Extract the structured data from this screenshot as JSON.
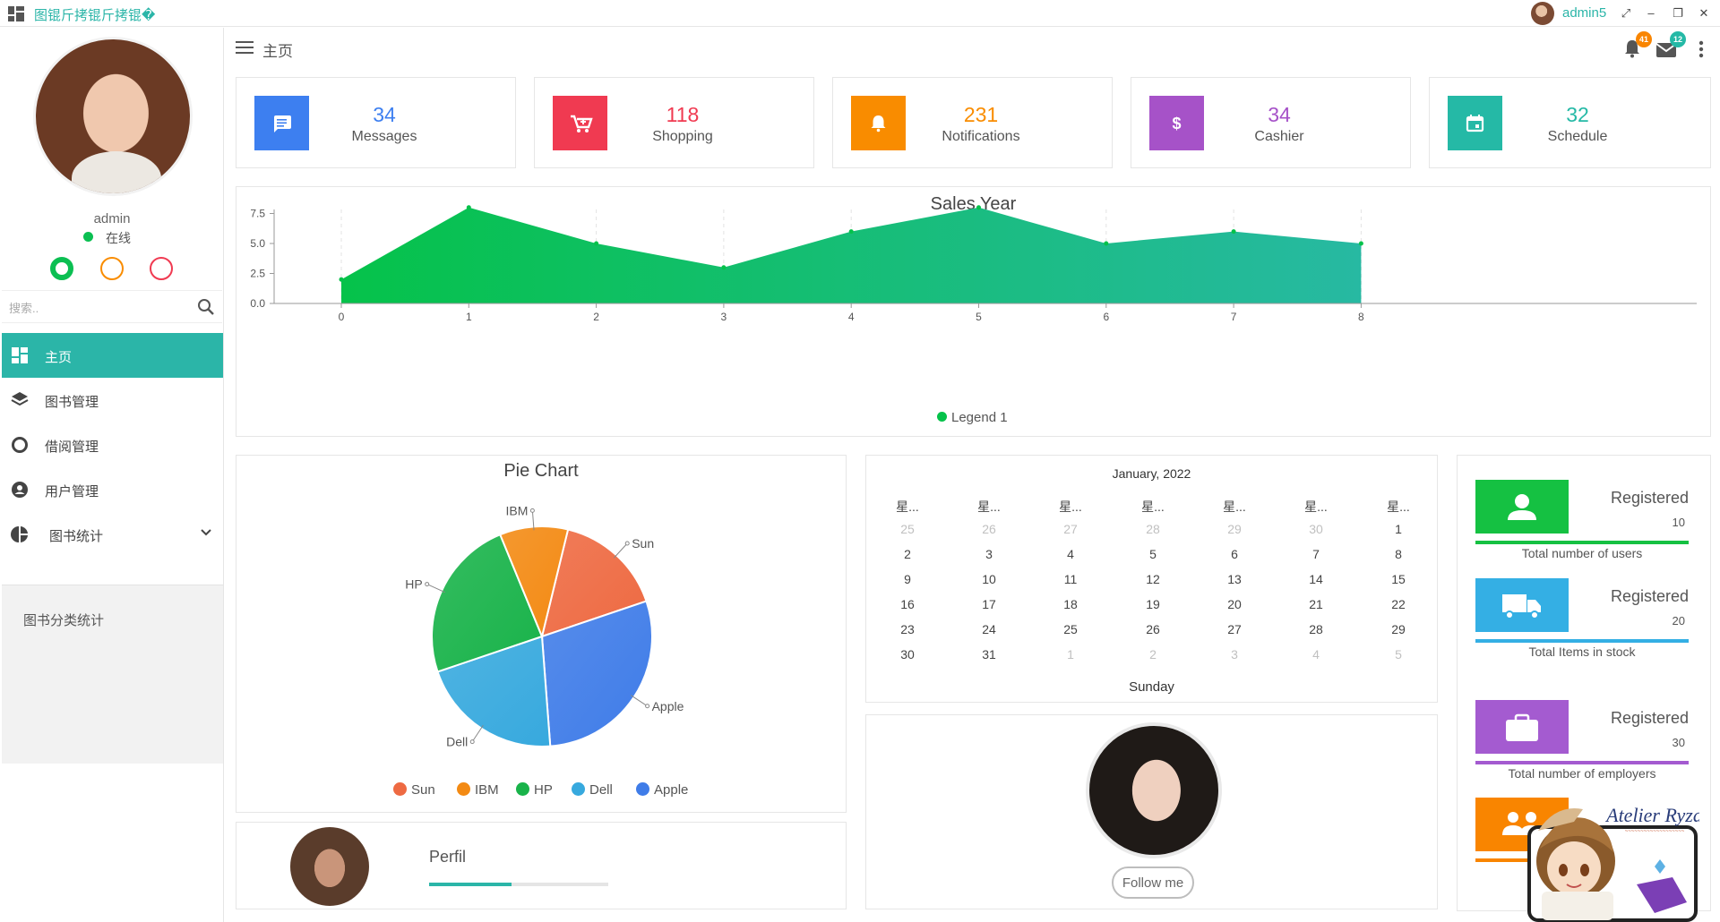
{
  "window": {
    "title": "图锟斤拷锟斤拷锟�",
    "user": "admin5"
  },
  "sidebar": {
    "profile_name": "admin",
    "status": "在线",
    "search_placeholder": "搜索..",
    "items": [
      {
        "label": "主页",
        "icon": "dashboard-icon",
        "active": true
      },
      {
        "label": "图书管理",
        "icon": "layers-icon"
      },
      {
        "label": "借阅管理",
        "icon": "circle-icon"
      },
      {
        "label": "用户管理",
        "icon": "account-circle-icon"
      },
      {
        "label": "图书统计",
        "icon": "pie-chart-icon"
      }
    ],
    "submenu": [
      "图书分类统计"
    ]
  },
  "header": {
    "title": "主页",
    "notifications_count": "41",
    "mail_count": "12"
  },
  "stats": [
    {
      "value": "34",
      "label": "Messages",
      "color": "#3d7ff0",
      "icon": "message-icon"
    },
    {
      "value": "118",
      "label": "Shopping",
      "color": "#f03a51",
      "icon": "cart-icon"
    },
    {
      "value": "231",
      "label": "Notifications",
      "color": "#f98c00",
      "icon": "bell-icon"
    },
    {
      "value": "34",
      "label": "Cashier",
      "color": "#a652c8",
      "icon": "dollar-icon"
    },
    {
      "value": "32",
      "label": "Schedule",
      "color": "#25b9a6",
      "icon": "calendar-icon"
    }
  ],
  "chart_data": [
    {
      "type": "area",
      "title": "Sales Year",
      "x": [
        0,
        1,
        2,
        3,
        4,
        5,
        6,
        7,
        8
      ],
      "series": [
        {
          "name": "Legend 1",
          "values": [
            2,
            8,
            5,
            3,
            6,
            8,
            5,
            6,
            5
          ]
        }
      ],
      "ylim": [
        0,
        10
      ],
      "yticks": [
        "0.0",
        "2.5",
        "5.0",
        "7.5",
        "10.0"
      ],
      "grid": "vertical dashed",
      "legend_position": "bottom",
      "colors": [
        "#05c24a",
        "#27b9a2"
      ]
    },
    {
      "type": "pie",
      "title": "Pie Chart",
      "labels": [
        "Sun",
        "IBM",
        "HP",
        "Dell",
        "Apple"
      ],
      "values": [
        16,
        10,
        24,
        21,
        29
      ],
      "colors": [
        "#ee6a42",
        "#f38a13",
        "#19b34a",
        "#37a9de",
        "#3f7ce8"
      ],
      "legend_position": "bottom"
    }
  ],
  "calendar": {
    "title": "January, 2022",
    "weekdays": [
      "星...",
      "星...",
      "星...",
      "星...",
      "星...",
      "星...",
      "星..."
    ],
    "weeks": [
      [
        "25",
        "26",
        "27",
        "28",
        "29",
        "30",
        "1"
      ],
      [
        "2",
        "3",
        "4",
        "5",
        "6",
        "7",
        "8"
      ],
      [
        "9",
        "10",
        "11",
        "12",
        "13",
        "14",
        "15"
      ],
      [
        "16",
        "17",
        "18",
        "19",
        "20",
        "21",
        "22"
      ],
      [
        "23",
        "24",
        "25",
        "26",
        "27",
        "28",
        "29"
      ],
      [
        "30",
        "31",
        "1",
        "2",
        "3",
        "4",
        "5"
      ]
    ],
    "footer": "Sunday"
  },
  "follow": {
    "button": "Follow me"
  },
  "perfil": {
    "label": "Perfil",
    "progress": 0.46
  },
  "registered": [
    {
      "title": "Registered",
      "count": "10",
      "desc": "Total number of users",
      "color": "#15c142",
      "icon": "person-icon"
    },
    {
      "title": "Registered",
      "count": "20",
      "desc": "Total Items in stock",
      "color": "#34afe4",
      "icon": "truck-icon"
    },
    {
      "title": "Registered",
      "count": "30",
      "desc": "Total number of employers",
      "color": "#a45bd0",
      "icon": "briefcase-icon"
    },
    {
      "title": "",
      "count": "",
      "desc": "",
      "color": "#f98500",
      "icon": "group-icon"
    }
  ],
  "sticker_text": "Atelier Ryza"
}
